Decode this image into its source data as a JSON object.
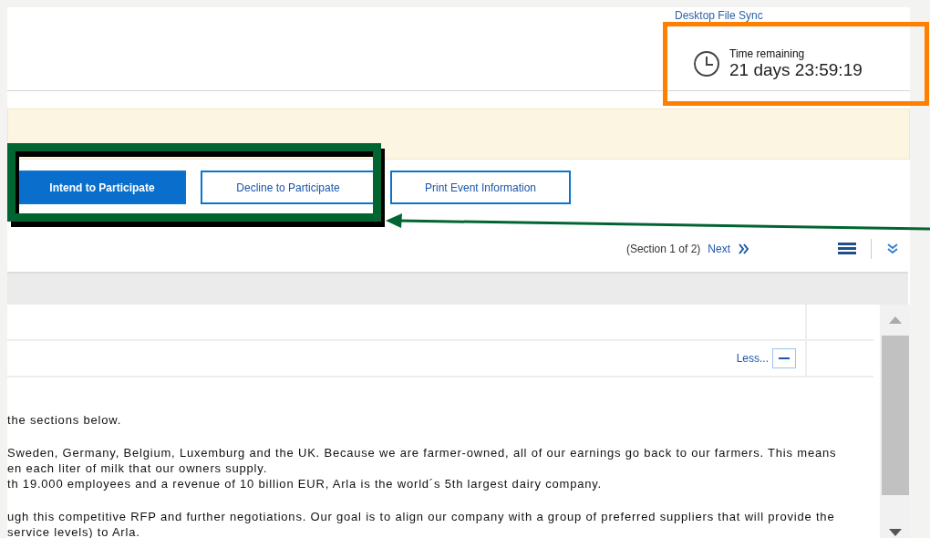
{
  "header": {
    "link": "Desktop File Sync"
  },
  "timer": {
    "label": "Time remaining",
    "value": "21 days 23:59:19"
  },
  "actions": [
    {
      "label": "Intend to Participate",
      "kind": "primary"
    },
    {
      "label": "Decline to Participate",
      "kind": "outline"
    },
    {
      "label": "Print Event Information",
      "kind": "outline"
    }
  ],
  "pager": {
    "section": "(Section 1 of 2)",
    "next": "Next"
  },
  "details": {
    "toggle": "Less...",
    "paragraphs": [
      {
        "lines": [
          "the sections below."
        ]
      },
      {
        "lines": [
          "Sweden, Germany, Belgium, Luxemburg and the UK. Because we are farmer-owned, all of our earnings go back to our farmers. This means",
          "en each liter of milk that our owners supply.",
          "th 19.000 employees and a revenue of 10 billion EUR, Arla is the world´s 5th largest dairy company."
        ]
      },
      {
        "lines": [
          "ugh this competitive RFP and further negotiations. Our goal is to align our company with a group of preferred suppliers that will provide the",
          "service levels) to Arla."
        ]
      }
    ]
  }
}
